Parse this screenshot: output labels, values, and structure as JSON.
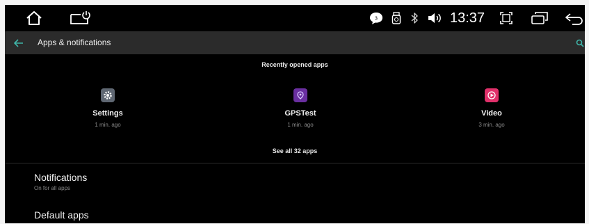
{
  "status_bar": {
    "time": "13:37",
    "notification_count": "3",
    "icons": [
      "home-icon",
      "power-window-icon",
      "chat-notification-icon",
      "sim-card-icon",
      "bluetooth-icon",
      "volume-icon",
      "screenshot-icon",
      "recent-apps-icon",
      "back-icon"
    ]
  },
  "app_bar": {
    "title": "Apps & notifications"
  },
  "recent": {
    "header": "Recently opened apps",
    "apps": [
      {
        "name": "Settings",
        "time": "1 min. ago",
        "icon": "settings-app-icon",
        "color": "#5f6772"
      },
      {
        "name": "GPSTest",
        "time": "1 min. ago",
        "icon": "gpstest-app-icon",
        "color": "#6a2fa0"
      },
      {
        "name": "Video",
        "time": "3 min. ago",
        "icon": "video-app-icon",
        "color": "#e0306a"
      }
    ],
    "see_all": "See all 32 apps"
  },
  "prefs": [
    {
      "title": "Notifications",
      "summary": "On for all apps"
    },
    {
      "title": "Default apps"
    }
  ],
  "colors": {
    "background": "#000000",
    "app_bar": "#2b2b2b",
    "accent": "#3fb4a8"
  }
}
